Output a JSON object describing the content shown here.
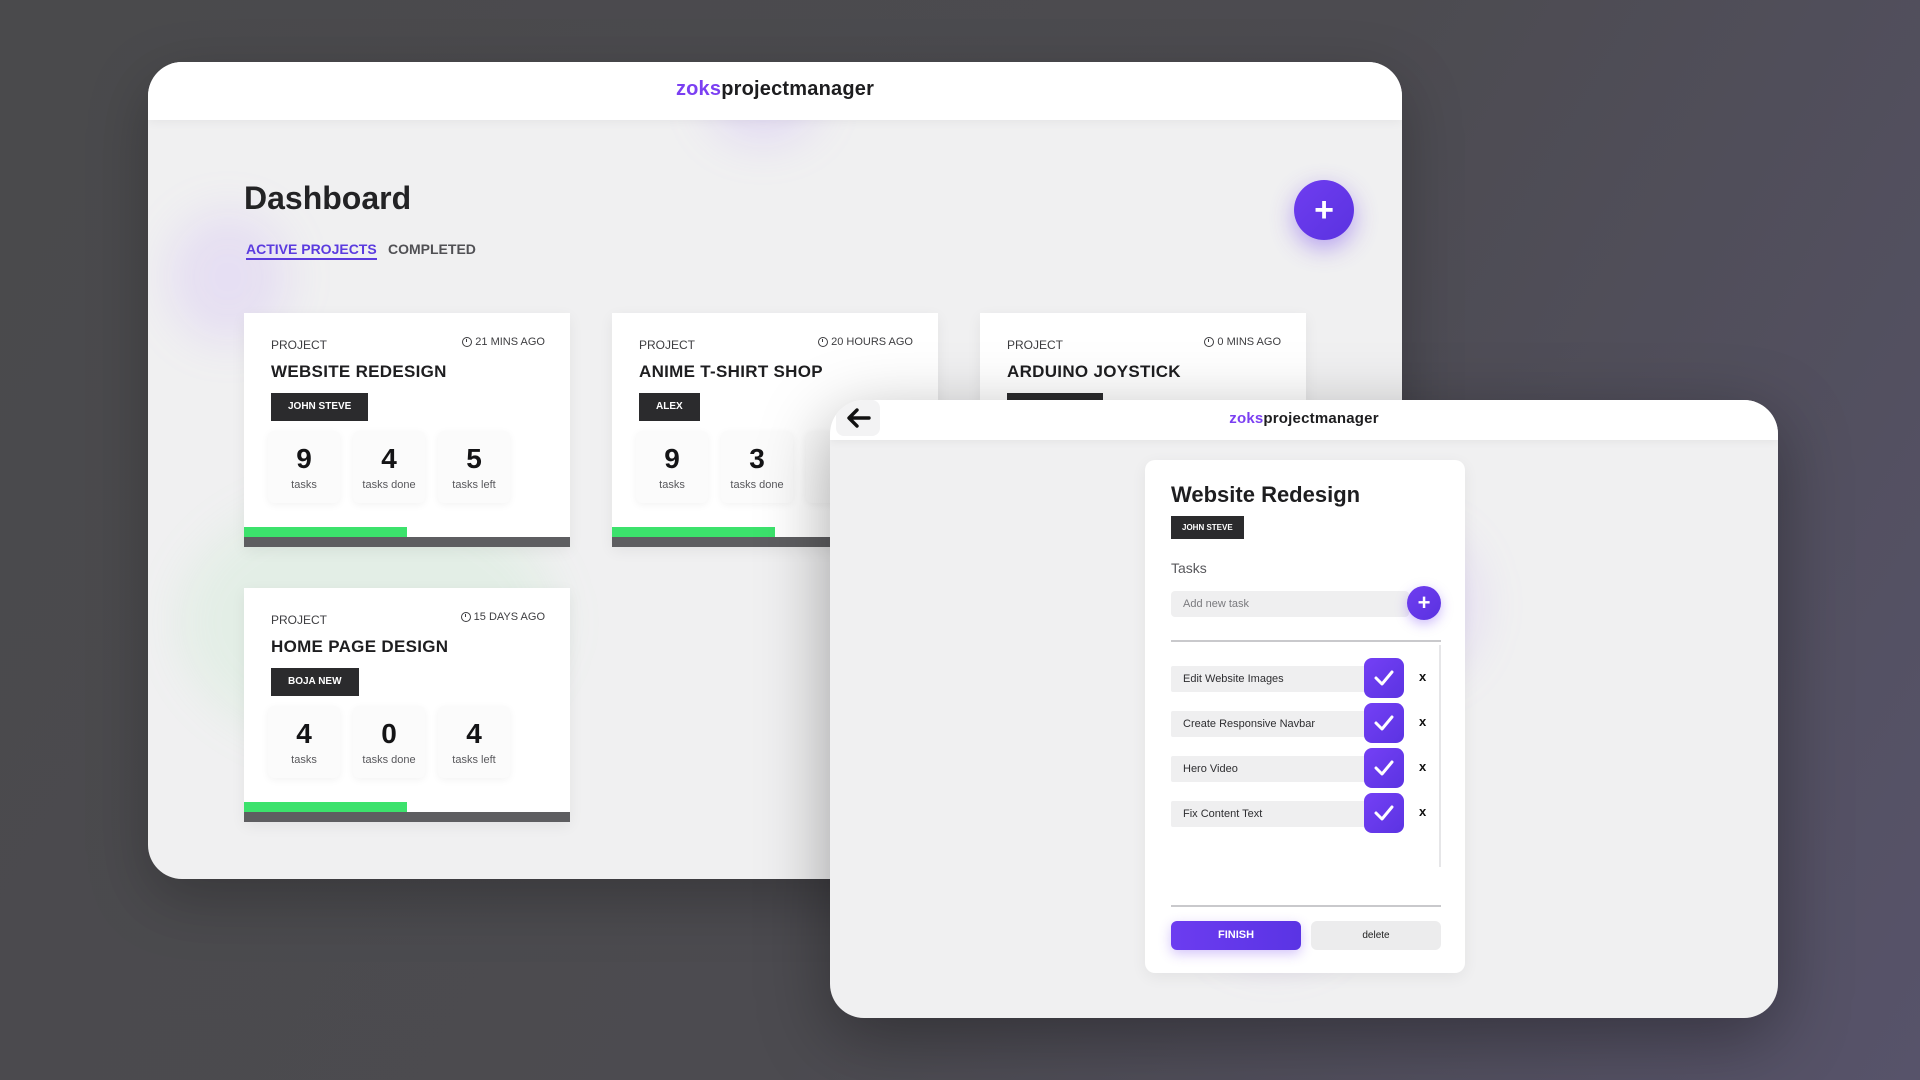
{
  "brand": {
    "accent": "zoks",
    "rest": "projectmanager"
  },
  "colors": {
    "accent": "#7b3ff2",
    "button": "#5f37e6",
    "progress": "#3ce26c",
    "track": "#5e5e61"
  },
  "dashboard": {
    "title": "Dashboard",
    "tabs": [
      {
        "label": "ACTIVE PROJECTS",
        "active": true
      },
      {
        "label": "COMPLETED",
        "active": false
      }
    ],
    "add_button_icon": "plus-icon",
    "projects": [
      {
        "label": "PROJECT",
        "time": "21 MINS AGO",
        "name": "WEBSITE REDESIGN",
        "owner": "JOHN STEVE",
        "stats": {
          "tasks": "9",
          "tasks_label": "tasks",
          "done": "4",
          "done_label": "tasks done",
          "left": "5",
          "left_label": "tasks left"
        },
        "progress": 0.5
      },
      {
        "label": "PROJECT",
        "time": "20 HOURS AGO",
        "name": "ANIME T-SHIRT SHOP",
        "owner": "ALEX",
        "stats": {
          "tasks": "9",
          "tasks_label": "tasks",
          "done": "3",
          "done_label": "tasks done"
        },
        "progress": 0.5
      },
      {
        "label": "PROJECT",
        "time": "0 MINS AGO",
        "name": "ARDUINO JOYSTICK"
      },
      {
        "label": "PROJECT",
        "time": "15 DAYS AGO",
        "name": "HOME PAGE DESIGN",
        "owner": "BOJA NEW",
        "stats": {
          "tasks": "4",
          "tasks_label": "tasks",
          "done": "0",
          "done_label": "tasks done",
          "left": "4",
          "left_label": "tasks left"
        },
        "progress": 0.5
      }
    ]
  },
  "detail": {
    "back_icon": "arrow-left-icon",
    "title": "Website Redesign",
    "owner": "JOHN STEVE",
    "tasks_label": "Tasks",
    "add_placeholder": "Add new task",
    "tasks": [
      {
        "text": "Edit Website Images"
      },
      {
        "text": "Create Responsive Navbar"
      },
      {
        "text": "Hero Video"
      },
      {
        "text": "Fix Content Text"
      }
    ],
    "delete_task_label": "x",
    "finish_label": "FINISH",
    "delete_label": "delete"
  }
}
